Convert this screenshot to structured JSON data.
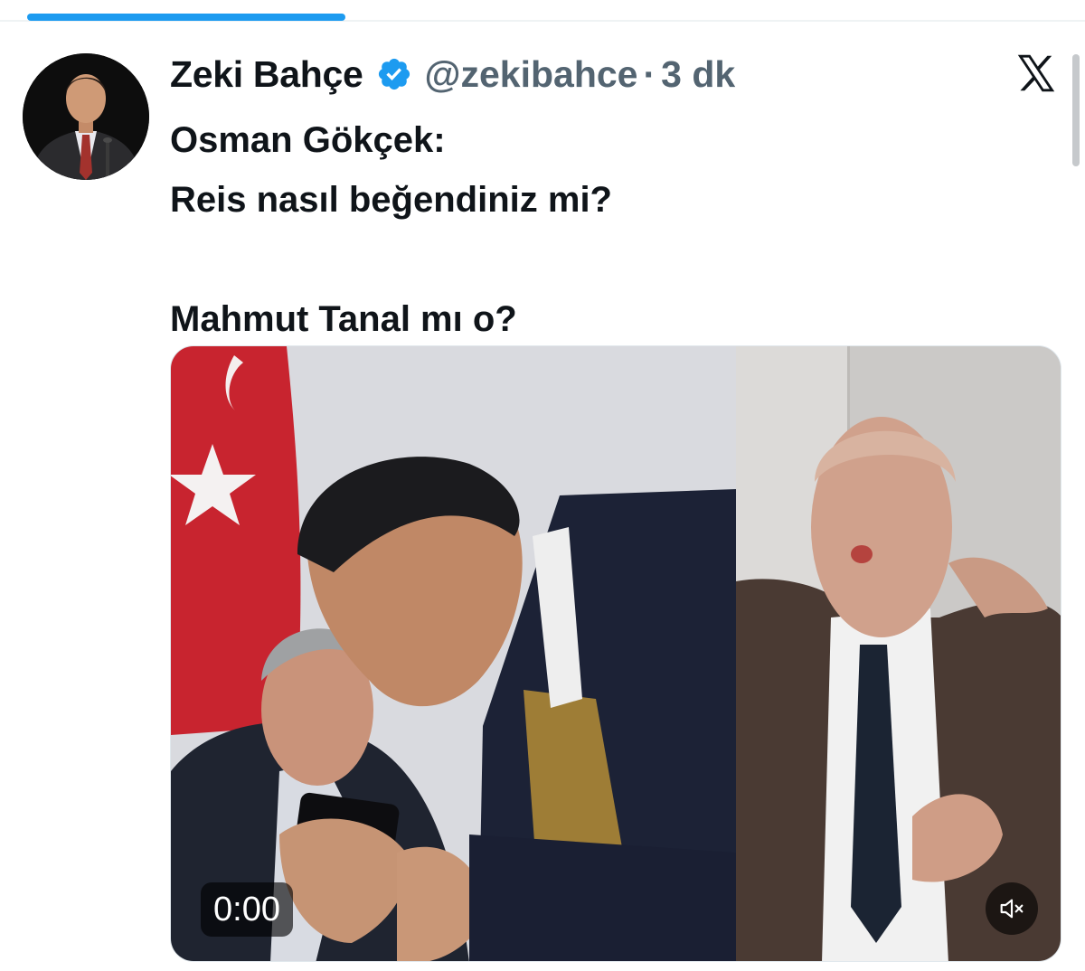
{
  "tweet": {
    "author_name": "Zeki Bahçe",
    "handle": "@zekibahce",
    "separator": "·",
    "time": "3 dk",
    "verified_icon": "verified-badge-icon",
    "text_lines": [
      "Osman Gökçek:",
      "Reis nasıl beğendiniz mi?",
      "",
      "Mahmut Tanal mı o?"
    ]
  },
  "media": {
    "type": "video",
    "time_label": "0:00",
    "mute_icon": "volume-muted-icon"
  },
  "brand": {
    "logo_icon": "x-logo-icon"
  },
  "colors": {
    "accent": "#1d9bf0",
    "text_primary": "#0f1419",
    "text_secondary": "#536471"
  }
}
